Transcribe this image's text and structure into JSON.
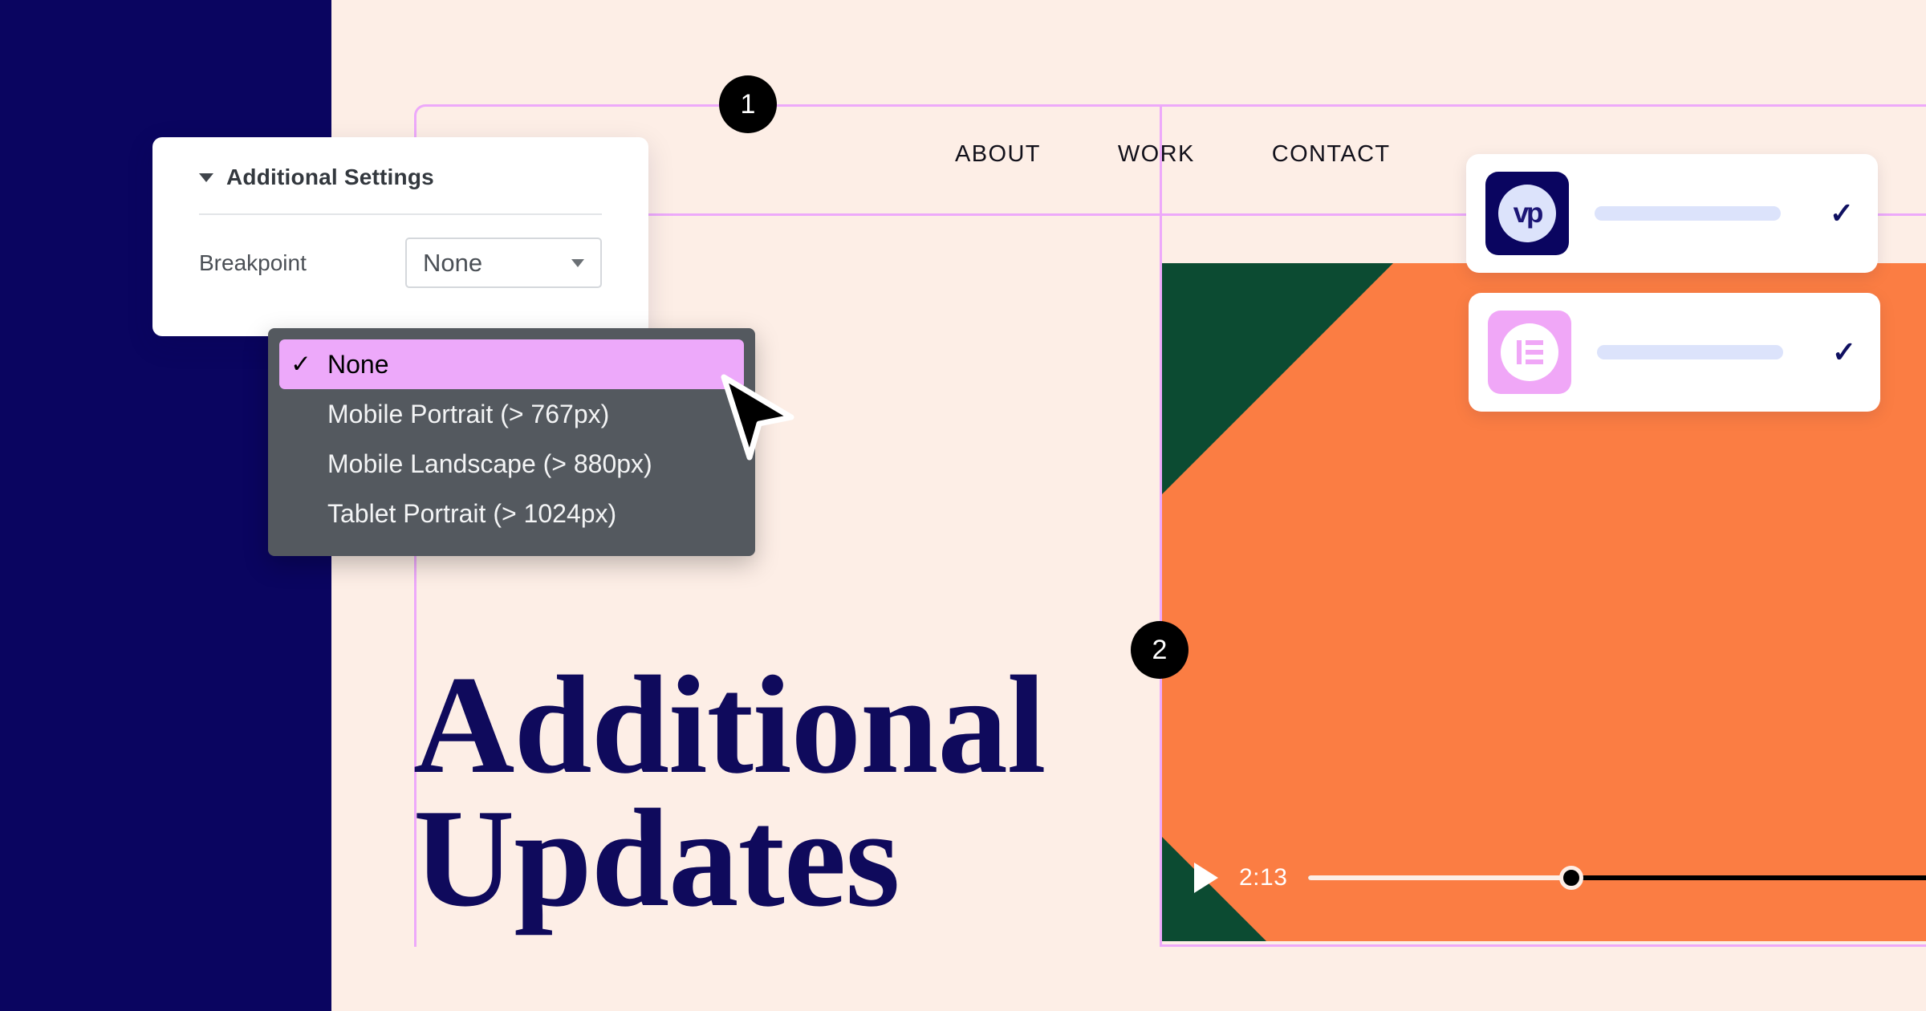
{
  "colors": {
    "background": "#FDEEE6",
    "navy": "#0A0560",
    "orange": "#FB7D43",
    "green": "#0C4B32",
    "guide_pink": "#EDA9FA",
    "dropdown_bg": "#54595F",
    "highlight_pink": "#EDA9FA",
    "heading_navy": "#0F0A5C",
    "placeholder_blue": "#DCE3FB"
  },
  "site": {
    "nav_items": [
      {
        "label": "ABOUT"
      },
      {
        "label": "WORK"
      },
      {
        "label": "CONTACT"
      }
    ],
    "heading_line_1": "Additional",
    "heading_line_2": "Updates"
  },
  "video": {
    "time": "2:13",
    "play_icon": "play-icon",
    "progress_percent": 42
  },
  "cards": [
    {
      "logo_name": "videopress-logo-icon",
      "logo_text": "vp",
      "check_icon": "✓"
    },
    {
      "logo_name": "elementor-logo-icon",
      "logo_text": "",
      "check_icon": "✓"
    }
  ],
  "badges": [
    {
      "number": "1"
    },
    {
      "number": "2"
    }
  ],
  "settings_panel": {
    "title": "Additional Settings",
    "collapse_icon": "caret-down-icon",
    "field_label": "Breakpoint",
    "select_value": "None",
    "select_caret_icon": "caret-down-icon"
  },
  "dropdown": {
    "check_icon": "✓",
    "options": [
      {
        "label": "None",
        "selected": true
      },
      {
        "label": "Mobile Portrait (> 767px)",
        "selected": false
      },
      {
        "label": "Mobile Landscape (> 880px)",
        "selected": false
      },
      {
        "label": "Tablet Portrait (> 1024px)",
        "selected": false
      }
    ]
  }
}
